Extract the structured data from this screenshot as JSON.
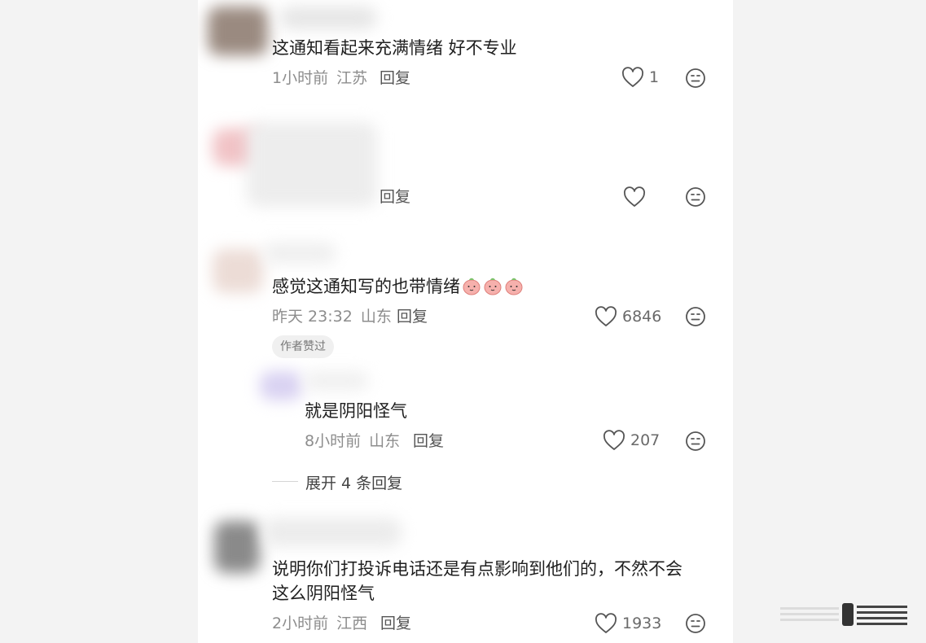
{
  "comments": [
    {
      "text": "这通知看起来充满情绪 好不专业",
      "time": "1小时前",
      "location": "江苏",
      "reply_label": "回复",
      "like_count": "1"
    },
    {
      "text": "",
      "reply_label": "回复",
      "like_count": ""
    },
    {
      "text": "感觉这通知写的也带情绪",
      "emoji": "peach-face-emoji",
      "time": "昨天 23:32",
      "location": "山东",
      "reply_label": "回复",
      "like_count": "6846",
      "badge": "作者赞过",
      "sub_reply": {
        "text": "就是阴阳怪气",
        "time": "8小时前",
        "location": "山东",
        "reply_label": "回复",
        "like_count": "207"
      },
      "expand_label": "展开 4 条回复"
    },
    {
      "text_line1": "说明你们打投诉电话还是有点影响到他们的，不然不会",
      "text_line2": "这么阴阳怪气",
      "time": "2小时前",
      "location": "江西",
      "reply_label": "回复",
      "like_count": "1933"
    }
  ],
  "icons": {
    "like": "heart-outline-icon",
    "reaction": "neutral-face-icon"
  },
  "colors": {
    "panel_bg": "#ffffff",
    "page_bg": "#f3f3f3",
    "text": "#1f1f1f",
    "meta": "#8d8d8d"
  }
}
